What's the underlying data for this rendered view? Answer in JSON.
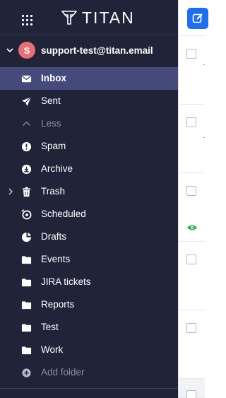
{
  "app": {
    "brand": "TITAN"
  },
  "account": {
    "initial": "S",
    "email": "support-test@titan.email",
    "avatar_color": "#e86f77"
  },
  "folders": [
    {
      "label": "Inbox",
      "icon": "envelope-icon",
      "active": true
    },
    {
      "label": "Sent",
      "icon": "send-icon"
    },
    {
      "label": "Less",
      "icon": "chevron-up-icon",
      "muted": true
    },
    {
      "label": "Spam",
      "icon": "alert-icon"
    },
    {
      "label": "Archive",
      "icon": "archive-icon"
    },
    {
      "label": "Trash",
      "icon": "trash-icon",
      "expandable": true
    },
    {
      "label": "Scheduled",
      "icon": "clock-icon"
    },
    {
      "label": "Drafts",
      "icon": "draft-icon"
    },
    {
      "label": "Events",
      "icon": "folder-icon"
    },
    {
      "label": "JIRA tickets",
      "icon": "folder-icon"
    },
    {
      "label": "Reports",
      "icon": "folder-icon"
    },
    {
      "label": "Test",
      "icon": "folder-icon"
    },
    {
      "label": "Work",
      "icon": "folder-icon"
    },
    {
      "label": "Add folder",
      "icon": "plus-circle-icon",
      "muted": true
    }
  ],
  "colors": {
    "sidebar_bg": "#212439",
    "active_bg": "#454a7a",
    "compose_btn": "#1f6feb",
    "eye_icon": "#2aa84a"
  }
}
